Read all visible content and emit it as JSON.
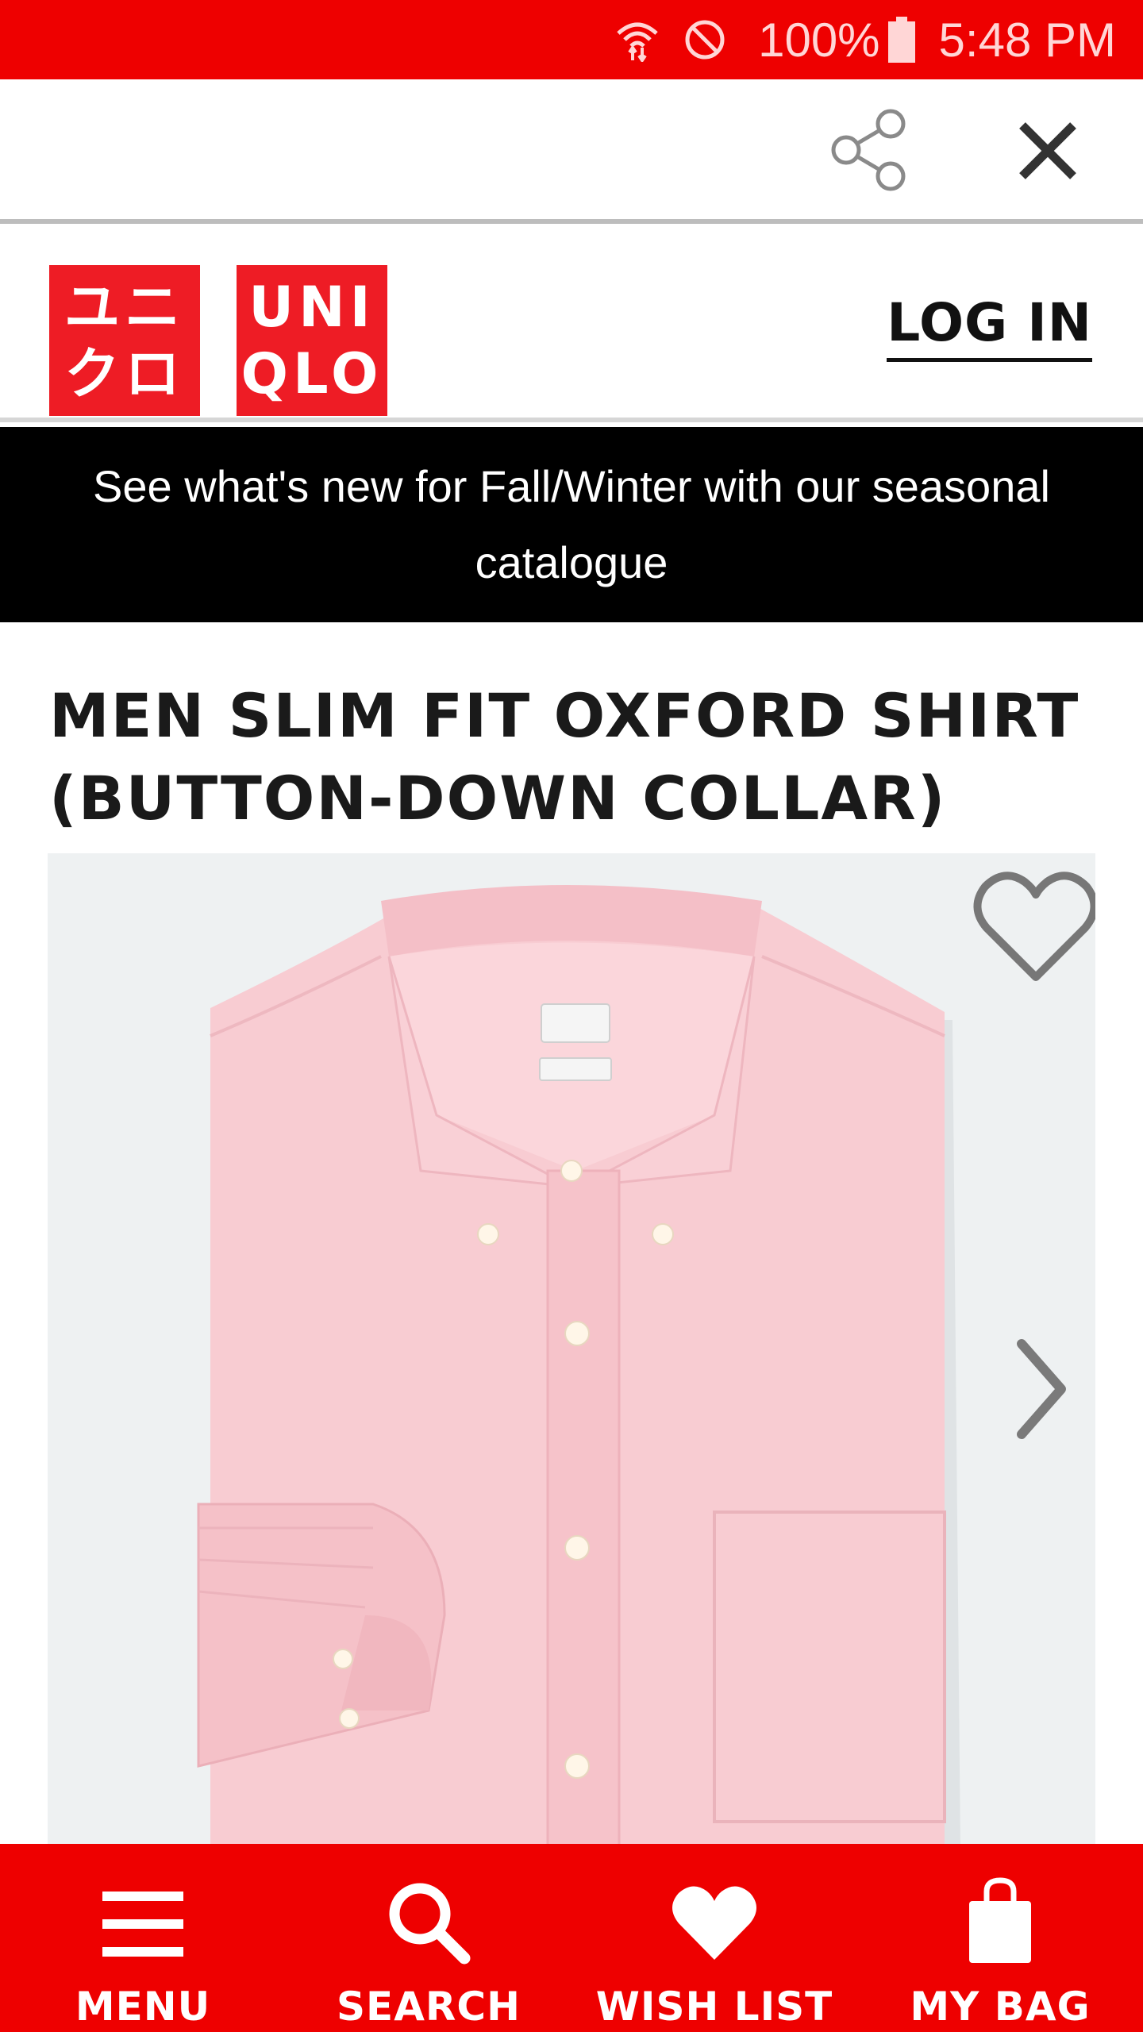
{
  "status_bar": {
    "battery": "100%",
    "time": "5:48 PM",
    "icons": [
      "wifi-data-icon",
      "do-not-disturb-icon",
      "battery-icon"
    ]
  },
  "toolbar": {
    "icons": [
      "share-icon",
      "close-icon"
    ]
  },
  "header": {
    "logo_kana_line1": "ユニ",
    "logo_kana_line2": "クロ",
    "logo_latin_line1": "UNI",
    "logo_latin_line2": "QLO",
    "login_label": "LOG IN"
  },
  "banner": {
    "text": "See what's new for Fall/Winter with our seasonal catalogue"
  },
  "product": {
    "title_line1": "MEN SLIM FIT OXFORD SHIRT",
    "title_line2": "(BUTTON-DOWN COLLAR)",
    "image_icons": [
      "heart-outline-icon",
      "chevron-right-icon"
    ]
  },
  "bottom_nav": {
    "items": [
      {
        "label": "MENU",
        "icon": "hamburger-icon"
      },
      {
        "label": "SEARCH",
        "icon": "search-icon"
      },
      {
        "label": "WISH LIST",
        "icon": "heart-icon"
      },
      {
        "label": "MY BAG",
        "icon": "bag-icon"
      }
    ]
  },
  "colors": {
    "brand_red": "#ee0000",
    "banner_black": "#000000",
    "shirt_pink": "#f7c9cf"
  }
}
